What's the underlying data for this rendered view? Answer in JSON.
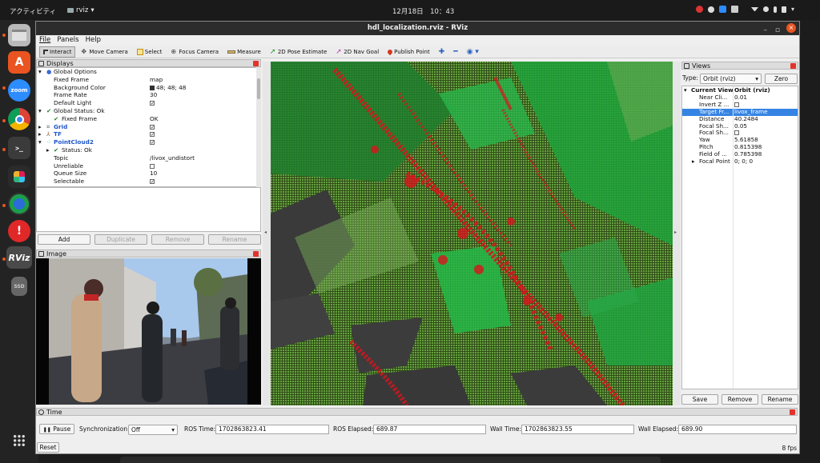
{
  "topbar": {
    "activities": "アクティビティ",
    "app_name": "rviz",
    "clock": "12月18日　10：43"
  },
  "dock": {
    "items": [
      "files-icon",
      "app-center-icon",
      "zoom-icon",
      "chrome-icon",
      "terminal-icon",
      "slack-icon",
      "browser-icon",
      "software-update-icon",
      "rviz-icon",
      "ssd-icon",
      "show-apps-icon"
    ],
    "zoom_label": "zoom",
    "rviz_label": "RViz",
    "ssd_label": "SSD"
  },
  "window": {
    "title": "hdl_localization.rviz - RViz"
  },
  "menu": {
    "file": "File",
    "panels": "Panels",
    "help": "Help"
  },
  "toolbar": {
    "interact": "Interact",
    "move_camera": "Move Camera",
    "select": "Select",
    "focus_camera": "Focus Camera",
    "measure": "Measure",
    "pose_estimate": "2D Pose Estimate",
    "nav_goal": "2D Nav Goal",
    "publish_point": "Publish Point"
  },
  "displays": {
    "title": "Displays",
    "rows": {
      "global_options": "Global Options",
      "fixed_frame_k": "Fixed Frame",
      "fixed_frame_v": "map",
      "bg_color_k": "Background Color",
      "bg_color_v": "48; 48; 48",
      "frame_rate_k": "Frame Rate",
      "frame_rate_v": "30",
      "default_light_k": "Default Light",
      "global_status": "Global Status: Ok",
      "gs_fixed_frame_k": "Fixed Frame",
      "gs_fixed_frame_v": "OK",
      "grid": "Grid",
      "tf": "TF",
      "pointcloud2": "PointCloud2",
      "pc_status": "Status: Ok",
      "topic_k": "Topic",
      "topic_v": "/livox_undistort",
      "unreliable_k": "Unreliable",
      "queue_size_k": "Queue Size",
      "queue_size_v": "10",
      "selectable_k": "Selectable"
    },
    "buttons": {
      "add": "Add",
      "duplicate": "Duplicate",
      "remove": "Remove",
      "rename": "Rename"
    }
  },
  "image_panel": {
    "title": "Image"
  },
  "views": {
    "title": "Views",
    "type_label": "Type:",
    "type_value": "Orbit (rviz)",
    "zero": "Zero",
    "current_view_k": "Current View",
    "current_view_v": "Orbit (rviz)",
    "near_clip_k": "Near Cli...",
    "near_clip_v": "0.01",
    "invert_z_k": "Invert Z ...",
    "target_frame_k": "Target Fr...",
    "target_frame_v": "livox_frame",
    "distance_k": "Distance",
    "distance_v": "40.2484",
    "focal_shape_size_k": "Focal Sh...",
    "focal_shape_size_v": "0.05",
    "focal_shape_fixed_k": "Focal Sh...",
    "yaw_k": "Yaw",
    "yaw_v": "5.61858",
    "pitch_k": "Pitch",
    "pitch_v": "0.815398",
    "fov_k": "Field of ...",
    "fov_v": "0.785398",
    "focal_point_k": "Focal Point",
    "focal_point_v": "0; 0; 0",
    "buttons": {
      "save": "Save",
      "remove": "Remove",
      "rename": "Rename"
    }
  },
  "time": {
    "title": "Time",
    "pause": "Pause",
    "sync_label": "Synchronization:",
    "sync_value": "Off",
    "ros_time_label": "ROS Time:",
    "ros_time": "1702863823.41",
    "ros_elapsed_label": "ROS Elapsed:",
    "ros_elapsed": "689.87",
    "wall_time_label": "Wall Time:",
    "wall_time": "1702863823.55",
    "wall_elapsed_label": "Wall Elapsed:",
    "wall_elapsed": "689.90",
    "reset": "Reset",
    "fps": "8 fps"
  },
  "colors": {
    "accent_orange": "#e95420",
    "selection_blue": "#3584e4",
    "pointcloud_green": "#3fbf3f",
    "pointcloud_red": "#d8141c"
  }
}
